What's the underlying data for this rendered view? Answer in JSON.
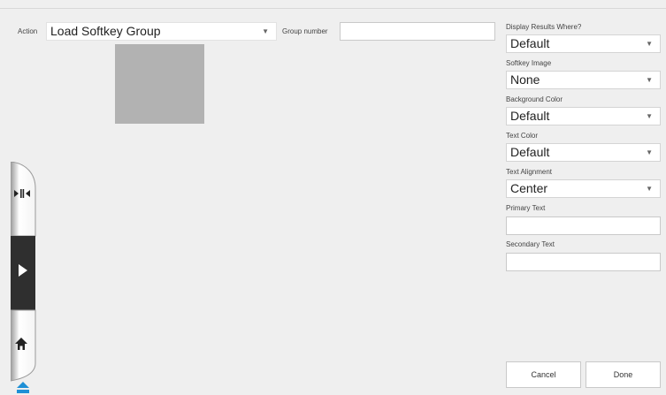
{
  "action": {
    "label": "Action",
    "selected": "Load Softkey Group"
  },
  "group_number": {
    "label": "Group number",
    "value": ""
  },
  "right_panel": {
    "display_results": {
      "label": "Display Results Where?",
      "value": "Default"
    },
    "softkey_image": {
      "label": "Softkey Image",
      "value": "None"
    },
    "background_color": {
      "label": "Background Color",
      "value": "Default"
    },
    "text_color": {
      "label": "Text Color",
      "value": "Default"
    },
    "text_alignment": {
      "label": "Text Alignment",
      "value": "Center"
    },
    "primary_text": {
      "label": "Primary Text",
      "value": ""
    },
    "secondary_text": {
      "label": "Secondary Text",
      "value": ""
    }
  },
  "buttons": {
    "cancel": "Cancel",
    "done": "Done"
  },
  "icons": {
    "dropdown": "chevron-down-icon",
    "dock_top": "collapse-arrows-icon",
    "dock_middle": "play-icon",
    "dock_bottom": "home-icon",
    "dock_footer": "eject-icon"
  },
  "colors": {
    "preview_swatch": "#b2b2b2",
    "dock_dark": "#2f2f2f",
    "eject_blue": "#1e90d6"
  }
}
